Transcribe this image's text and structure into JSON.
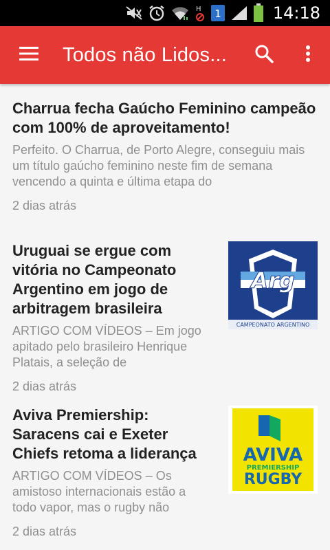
{
  "status_bar": {
    "time": "14:18",
    "icons": [
      "mute-icon",
      "alarm-icon",
      "wifi-icon",
      "no-data-icon",
      "notification-badge-icon",
      "signal-icon",
      "battery-icon"
    ],
    "notification_count": "1"
  },
  "appbar": {
    "title": "Todos não Lidos...",
    "color": "#e53935"
  },
  "articles": [
    {
      "title": "Charrua fecha Gaúcho Feminino campeão com 100% de aproveitamento!",
      "excerpt": "Perfeito. O Charrua, de Porto Alegre, conseguiu mais um título gaúcho feminino neste fim de semana vencendo a quinta e última etapa do",
      "time": "2 dias atrás"
    },
    {
      "title": "Uruguai se ergue com vitória no Campeonato Argentino em jogo de arbitragem brasileira",
      "excerpt": "ARTIGO COM VÍDEOS – Em jogo apitado pelo brasileiro Henrique Platais, a seleção de",
      "time": "2 dias atrás",
      "thumb": {
        "logo_text": "Arg",
        "caption": "CAMPEONATO ARGENTINO"
      }
    },
    {
      "title": "Aviva Premiership: Saracens cai e Exeter Chiefs retoma a liderança",
      "excerpt": "ARTIGO COM VÍDEOS – Os amistoso internacionais estão a todo vapor, mas o rugby não",
      "time": "2 dias atrás",
      "thumb": {
        "logo_text": "AVIVA",
        "subtitle": "PREMIERSHIP",
        "caption": "RUGBY"
      }
    }
  ]
}
